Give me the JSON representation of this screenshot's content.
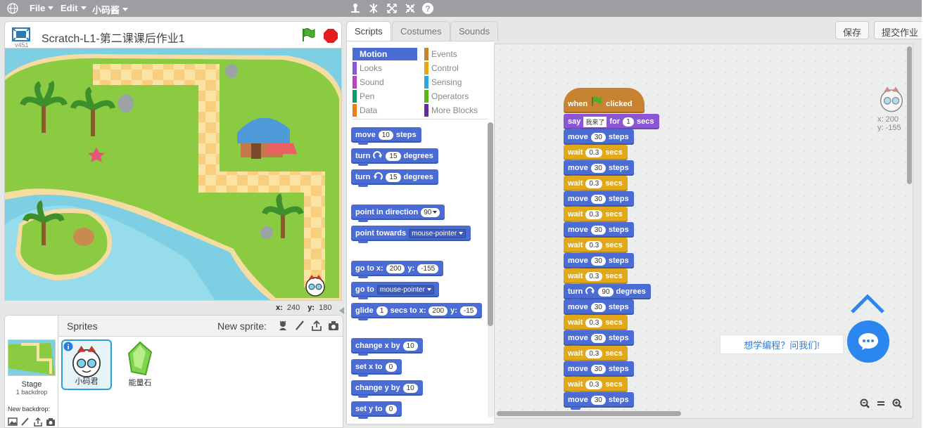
{
  "menubar": {
    "file": "File",
    "edit": "Edit",
    "user": "小码酱",
    "globe_icon": "globe-icon",
    "tools": [
      "duplicate-icon",
      "delete-icon",
      "grow-icon",
      "shrink-icon",
      "help-icon"
    ]
  },
  "stage": {
    "title": "Scratch-L1-第二课课后作业1",
    "version": "v451",
    "coord_x_label": "x:",
    "coord_x": "240",
    "coord_y_label": "y:",
    "coord_y": "180"
  },
  "sprites_pane": {
    "title": "Sprites",
    "new_sprite": "New sprite:",
    "stage_label": "Stage",
    "backdrop_count": "1 backdrop",
    "new_backdrop": "New backdrop:",
    "sprites": [
      {
        "name": "小码君",
        "selected": true
      },
      {
        "name": "能量石",
        "selected": false
      }
    ]
  },
  "tabs": [
    "Scripts",
    "Costumes",
    "Sounds"
  ],
  "buttons": {
    "save": "保存",
    "submit": "提交作业"
  },
  "categories_left": [
    "Motion",
    "Looks",
    "Sound",
    "Pen",
    "Data"
  ],
  "categories_right": [
    "Events",
    "Control",
    "Sensing",
    "Operators",
    "More Blocks"
  ],
  "category_colors": {
    "Motion": "#4a6cd4",
    "Looks": "#8a55d7",
    "Sound": "#bb42c3",
    "Pen": "#0e9a6c",
    "Data": "#ee7d16",
    "Events": "#c88330",
    "Control": "#e1a91a",
    "Sensing": "#2ca5e2",
    "Operators": "#5cb712",
    "More Blocks": "#632d99"
  },
  "palette_blocks": {
    "move": {
      "a": "move",
      "v": "10",
      "b": "steps"
    },
    "turn_cw": {
      "a": "turn",
      "v": "15",
      "b": "degrees"
    },
    "turn_ccw": {
      "a": "turn",
      "v": "15",
      "b": "degrees"
    },
    "point_dir": {
      "a": "point in direction",
      "v": "90"
    },
    "point_towards": {
      "a": "point towards",
      "v": "mouse-pointer"
    },
    "goto_xy": {
      "a": "go to x:",
      "x": "200",
      "b": "y:",
      "y": "-155"
    },
    "goto": {
      "a": "go to",
      "v": "mouse-pointer"
    },
    "glide": {
      "a": "glide",
      "v": "1",
      "b": "secs to x:",
      "x": "200",
      "c": "y:",
      "y": "-15"
    },
    "change_x": {
      "a": "change x by",
      "v": "10"
    },
    "set_x": {
      "a": "set x to",
      "v": "0"
    },
    "change_y": {
      "a": "change y by",
      "v": "10"
    },
    "set_y": {
      "a": "set y to",
      "v": "0"
    }
  },
  "script": {
    "hat": {
      "a": "when",
      "b": "clicked"
    },
    "say": {
      "a": "say",
      "text": "我来了",
      "b": "for",
      "v": "1",
      "c": "secs"
    },
    "move": {
      "a": "move",
      "v": "30",
      "b": "steps"
    },
    "wait": {
      "a": "wait",
      "v": "0.3",
      "b": "secs"
    },
    "turn": {
      "a": "turn",
      "v": "90",
      "b": "degrees"
    }
  },
  "sprite_info": {
    "x": "x: 200",
    "y": "y: -155"
  },
  "chat": {
    "text": "想学编程？问我们!"
  }
}
